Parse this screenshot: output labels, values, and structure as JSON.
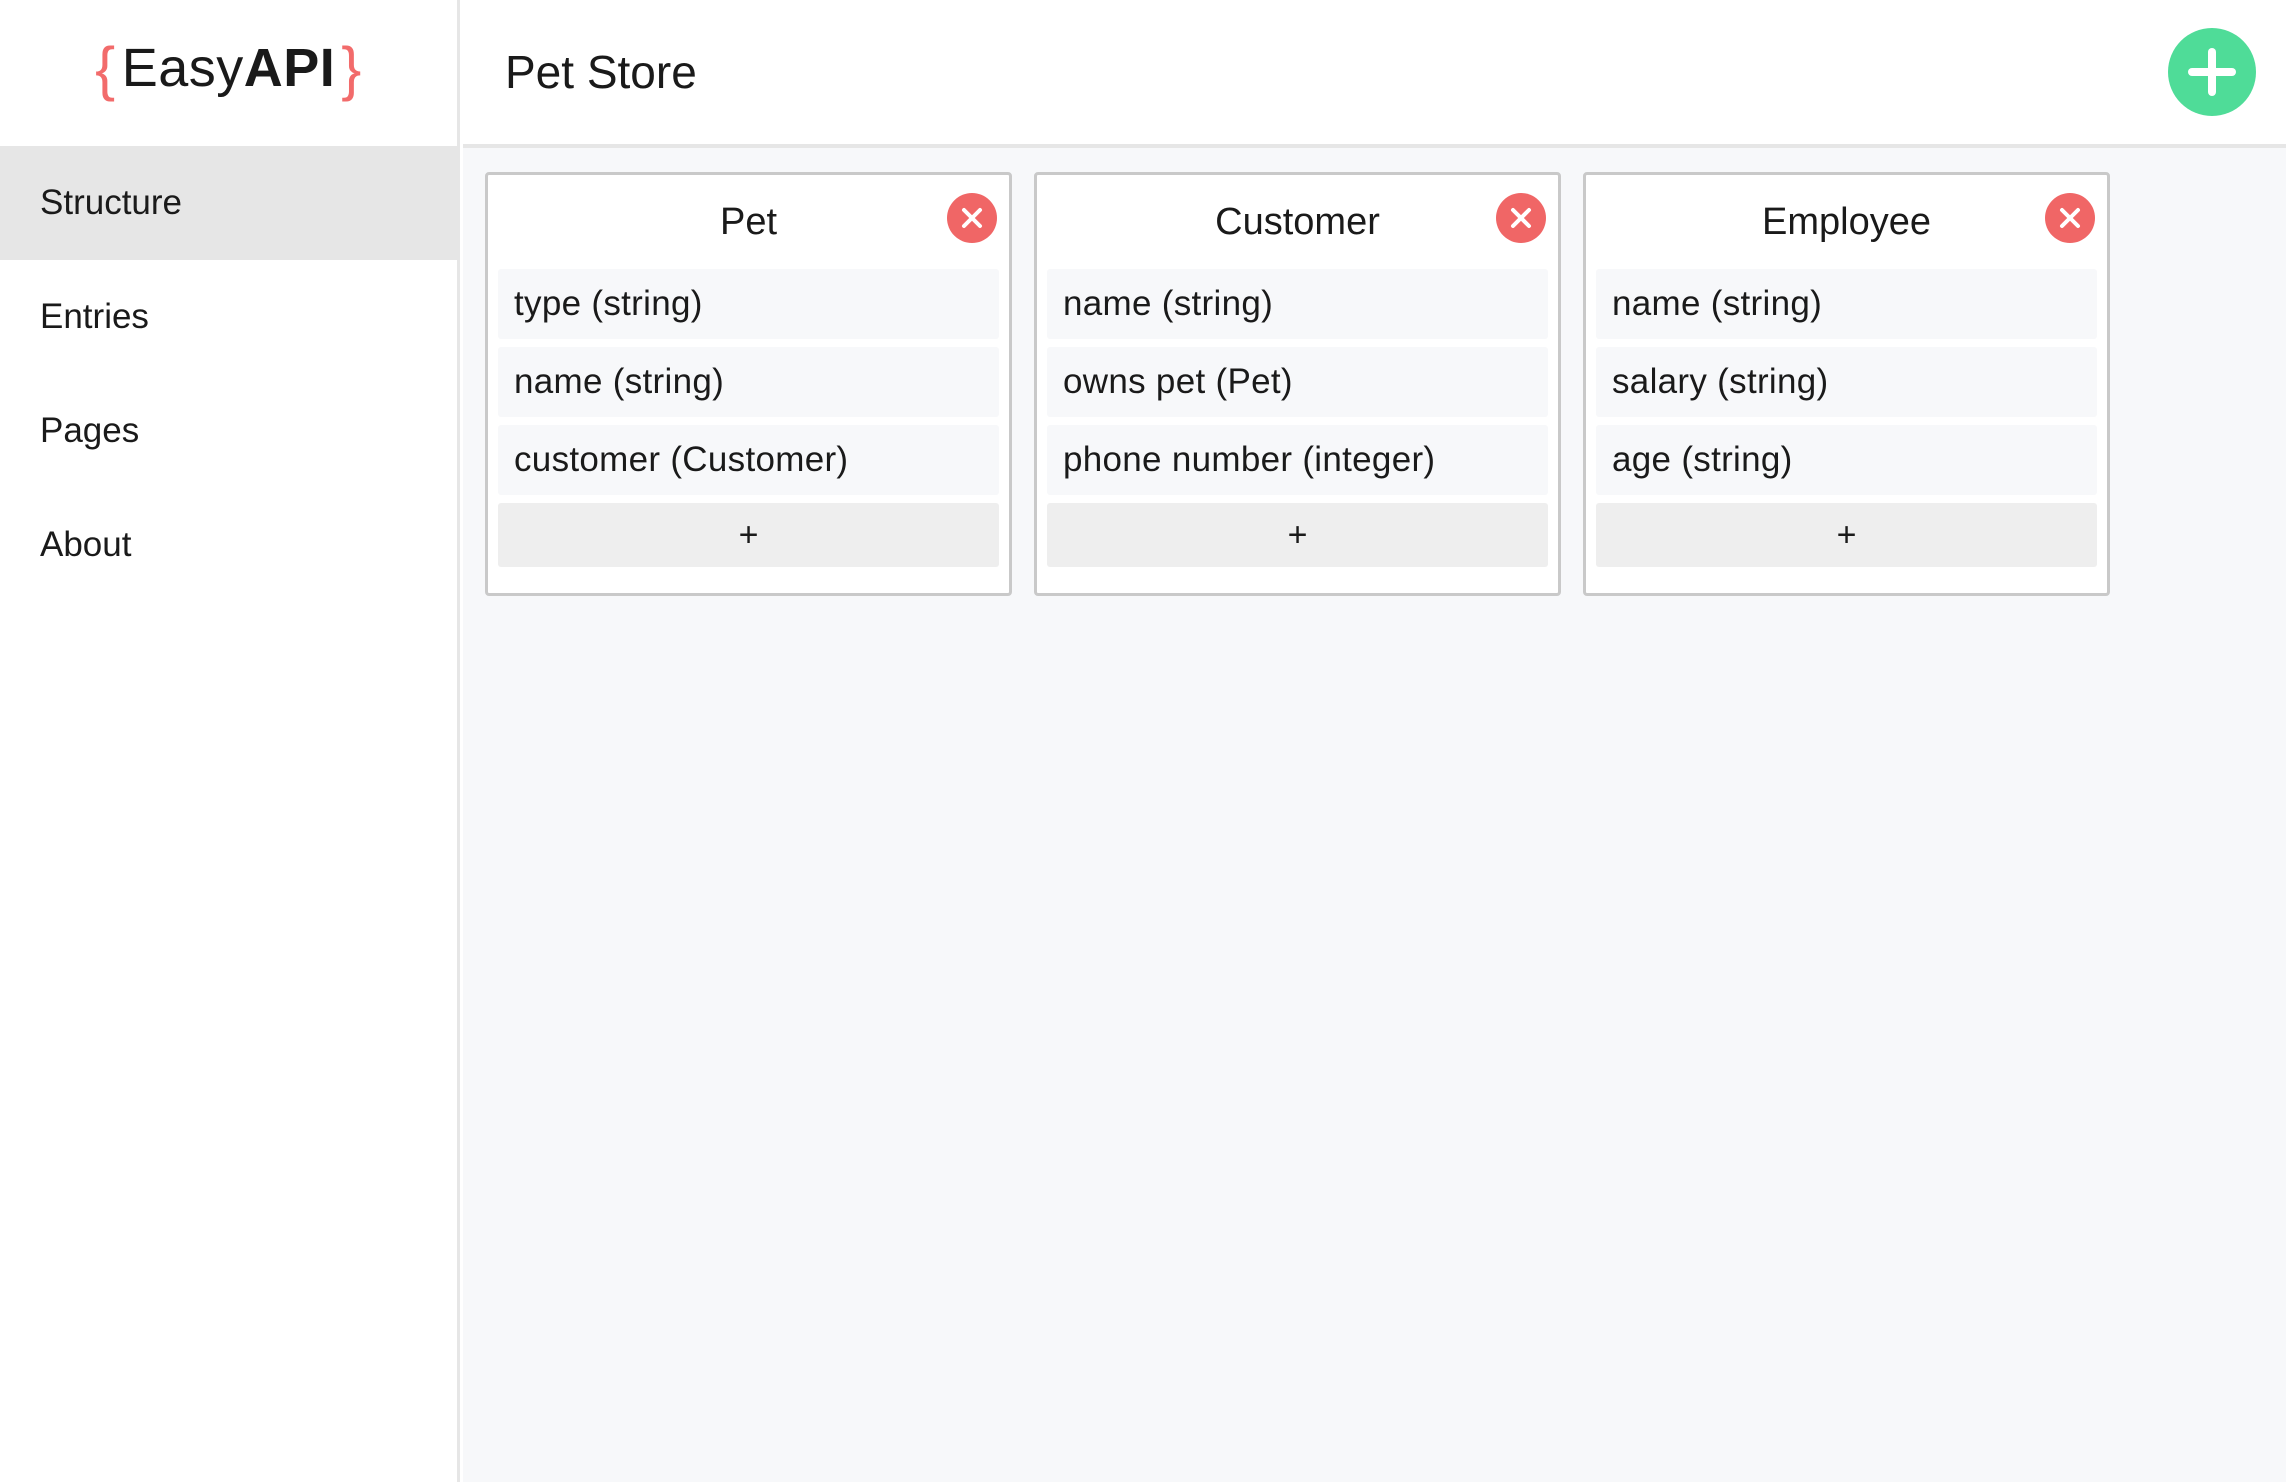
{
  "logo": {
    "brace_open": "{",
    "text_regular": "Easy",
    "text_bold": "API",
    "brace_close": "}",
    "brace_color": "#f26b6b"
  },
  "sidebar": {
    "items": [
      {
        "label": "Structure",
        "active": true
      },
      {
        "label": "Entries",
        "active": false
      },
      {
        "label": "Pages",
        "active": false
      },
      {
        "label": "About",
        "active": false
      }
    ]
  },
  "header": {
    "title": "Pet Store",
    "add_button_icon": "plus-icon",
    "add_button_color": "#4fdc98"
  },
  "models": [
    {
      "name": "Pet",
      "delete_icon": "close-icon",
      "fields": [
        "type (string)",
        "name (string)",
        "customer (Customer)"
      ],
      "add_field_label": "+"
    },
    {
      "name": "Customer",
      "delete_icon": "close-icon",
      "fields": [
        "name (string)",
        "owns pet (Pet)",
        "phone number (integer)"
      ],
      "add_field_label": "+"
    },
    {
      "name": "Employee",
      "delete_icon": "close-icon",
      "fields": [
        "name (string)",
        "salary (string)",
        "age (string)"
      ],
      "add_field_label": "+"
    }
  ],
  "colors": {
    "delete_button": "#f06666",
    "active_nav_bg": "#e6e6e6",
    "main_bg": "#f7f8fa"
  }
}
